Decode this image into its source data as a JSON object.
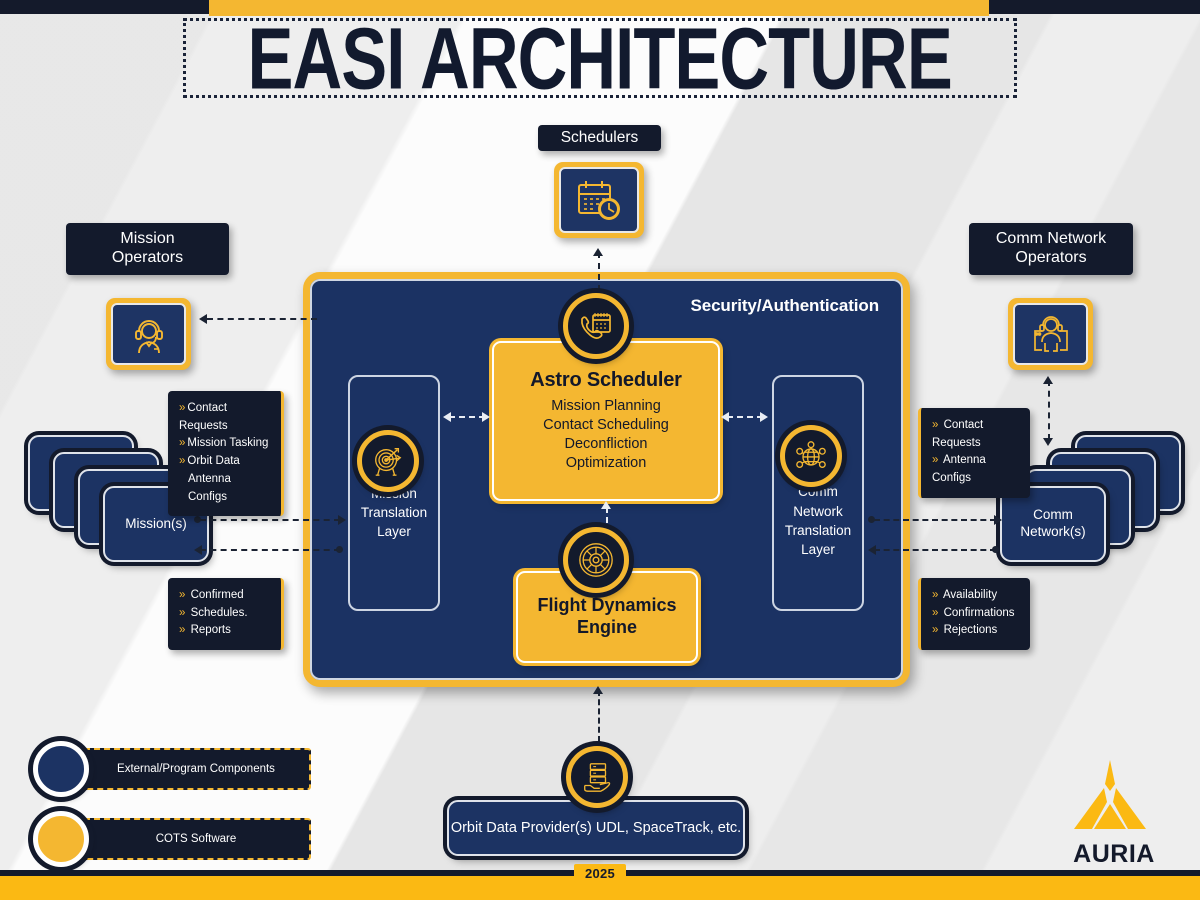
{
  "header": {
    "title": "EASI ARCHITECTURE",
    "year_badge": "2025"
  },
  "main_panel": {
    "security_label": "Security/Authentication",
    "astro_scheduler": {
      "title": "Astro Scheduler",
      "lines": [
        "Mission Planning",
        "Contact Scheduling",
        "Deconfliction",
        "Optimization"
      ],
      "icon": "phone-calendar-icon"
    },
    "flight_dynamics": {
      "title": "Flight Dynamics Engine",
      "icon": "orbit-wheel-icon"
    },
    "mission_translation_layer": {
      "label": "Mission Translation Layer",
      "icon": "target-arrows-icon"
    },
    "comm_translation_layer": {
      "label": "Comm Network Translation Layer",
      "icon": "network-globe-icon"
    }
  },
  "top": {
    "schedulers_label": "Schedulers",
    "schedulers_icon": "calendar-clock-icon"
  },
  "left": {
    "operators_label_line1": "Mission",
    "operators_label_line2": "Operators",
    "operators_icon": "headset-operator-icon",
    "inputs_note": [
      "Contact Requests",
      "Mission Tasking",
      "Orbit Data",
      "Antenna Configs"
    ],
    "outputs_note": [
      "Confirmed",
      "Schedules.",
      "Reports"
    ],
    "stack_label": "Mission(s)"
  },
  "right": {
    "operators_label_line1": "Comm Network",
    "operators_label_line2": "Operators",
    "operators_icon": "network-operator-icon",
    "inputs_note": [
      "Contact Requests",
      "Antenna Configs"
    ],
    "outputs_note": [
      "Availability",
      "Confirmations",
      "Rejections"
    ],
    "stack_label_line1": "Comm",
    "stack_label_line2": "Network(s)"
  },
  "bottom": {
    "orbit_provider_label": "Orbit Data Provider(s) UDL, SpaceTrack, etc.",
    "orbit_provider_icon": "data-hand-icon"
  },
  "legend": {
    "items": [
      {
        "label": "External/Program Components",
        "color": "#1c3363"
      },
      {
        "label": "COTS Software",
        "color": "#f4b731"
      }
    ]
  },
  "brand": {
    "name": "AURIA",
    "logo_icon": "auria-spire-logo"
  },
  "colors": {
    "navy": "#1b3263",
    "dark": "#131a2c",
    "gold": "#f4b731",
    "background": "#eeeeee"
  }
}
